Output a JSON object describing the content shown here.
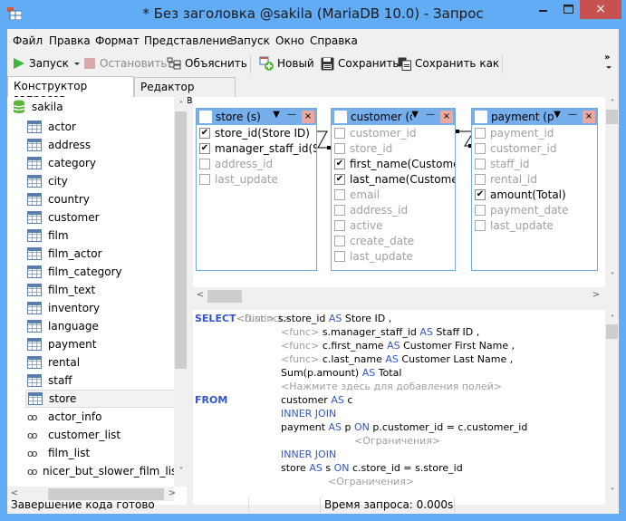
{
  "window": {
    "title": "* Без заголовка @sakila (MariaDB 10.0) - Запрос",
    "minimize": "‒",
    "maximize": "☐",
    "close": "×"
  },
  "menu": [
    "Файл",
    "Правка",
    "Формат",
    "Представление",
    "Запуск",
    "Окно",
    "Справка"
  ],
  "toolbar": {
    "run": "Запуск",
    "stop": "Остановить",
    "explain": "Объяснить",
    "new": "Новый",
    "save": "Сохранить",
    "save_as": "Сохранить как",
    "overflow": "»"
  },
  "tabs": [
    "Конструктор запросов",
    "Редактор запросов"
  ],
  "tree": {
    "root": "sakila",
    "tables": [
      "actor",
      "address",
      "category",
      "city",
      "country",
      "customer",
      "film",
      "film_actor",
      "film_category",
      "film_text",
      "inventory",
      "language",
      "payment",
      "rental",
      "staff",
      "store"
    ],
    "views": [
      "actor_info",
      "customer_list",
      "film_list",
      "nicer_but_slower_film_list"
    ],
    "selected": "store"
  },
  "designer": {
    "tables": [
      {
        "title": "store (s)",
        "fields": [
          {
            "name": "store_id(Store ID)",
            "checked": true
          },
          {
            "name": "manager_staff_id(Sta",
            "checked": true
          },
          {
            "name": "address_id",
            "checked": false
          },
          {
            "name": "last_update",
            "checked": false
          }
        ]
      },
      {
        "title": "customer (c)",
        "fields": [
          {
            "name": "customer_id",
            "checked": false
          },
          {
            "name": "store_id",
            "checked": false
          },
          {
            "name": "first_name(Customer F",
            "checked": true
          },
          {
            "name": "last_name(Customer L",
            "checked": true
          },
          {
            "name": "email",
            "checked": false
          },
          {
            "name": "address_id",
            "checked": false
          },
          {
            "name": "active",
            "checked": false
          },
          {
            "name": "create_date",
            "checked": false
          },
          {
            "name": "last_update",
            "checked": false
          }
        ]
      },
      {
        "title": "payment (p)",
        "fields": [
          {
            "name": "payment_id",
            "checked": false
          },
          {
            "name": "customer_id",
            "checked": false
          },
          {
            "name": "staff_id",
            "checked": false
          },
          {
            "name": "rental_id",
            "checked": false
          },
          {
            "name": "amount(Total)",
            "checked": true
          },
          {
            "name": "payment_date",
            "checked": false
          },
          {
            "name": "last_update",
            "checked": false
          }
        ]
      }
    ]
  },
  "sql": {
    "select": "SELECT",
    "distinct": "<Distinct>",
    "func": "<func>",
    "as": "AS",
    "on": "ON",
    "from": "FROM",
    "inner_join": "INNER JOIN",
    "fields": [
      {
        "expr": "s.store_id",
        "alias": "Store ID ,"
      },
      {
        "expr": "s.manager_staff_id",
        "alias": "Staff ID ,"
      },
      {
        "expr": "c.first_name",
        "alias": "Customer First Name ,"
      },
      {
        "expr": "c.last_name",
        "alias": "Customer Last Name ,"
      }
    ],
    "agg_expr": "Sum(p.amount)",
    "agg_alias": "Total",
    "add_fields_hint": "<Нажмите здесь для добавления полей>",
    "from_table": "customer",
    "from_alias": "c",
    "join1_table": "payment",
    "join1_alias": "p",
    "join1_cond": "p.customer_id = c.customer_id",
    "join2_table": "store",
    "join2_alias": "s",
    "join2_cond": "c.store_id = s.store_id",
    "constraints": "<Ограничения>"
  },
  "status": {
    "left": "Завершение кода готово",
    "query_time": "Время запроса: 0.000s"
  }
}
